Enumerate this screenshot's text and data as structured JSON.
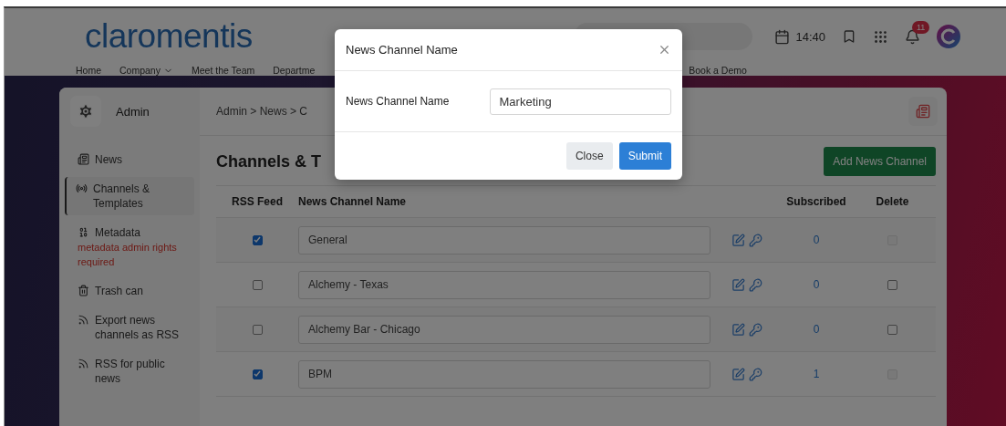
{
  "header": {
    "logo": "claromentis",
    "time": "14:40",
    "notification_count": "11",
    "nav": [
      {
        "label": "Home",
        "dropdown": false
      },
      {
        "label": "Company",
        "dropdown": true
      },
      {
        "label": "Meet the Team",
        "dropdown": false
      },
      {
        "label": "Departme",
        "dropdown": false
      },
      {
        "label": "Book a Demo",
        "dropdown": false
      }
    ]
  },
  "sidebar": {
    "title": "Admin",
    "items": [
      {
        "label": "News",
        "kind": "news",
        "selected": false
      },
      {
        "label": "Channels & Templates",
        "kind": "broadcast",
        "selected": true
      },
      {
        "label": "Metadata",
        "kind": "metadata",
        "selected": false,
        "note": "metadata admin rights required"
      },
      {
        "label": "Trash can",
        "kind": "trash",
        "selected": false
      },
      {
        "label": "Export news channels as RSS",
        "kind": "rss",
        "selected": false
      },
      {
        "label": "RSS for public news",
        "kind": "rss",
        "selected": false
      }
    ]
  },
  "breadcrumb": "Admin > News > C",
  "page_title": "Channels & T",
  "add_button": "Add News Channel",
  "table": {
    "columns": [
      "RSS Feed",
      "News Channel Name",
      "Subscribed",
      "Delete"
    ],
    "rows": [
      {
        "rss_feed": true,
        "name": "General",
        "subscribed": "0",
        "delete_checked": false,
        "delete_disabled": true
      },
      {
        "rss_feed": false,
        "name": "Alchemy - Texas",
        "subscribed": "0",
        "delete_checked": false,
        "delete_disabled": false
      },
      {
        "rss_feed": false,
        "name": "Alchemy Bar - Chicago",
        "subscribed": "0",
        "delete_checked": false,
        "delete_disabled": false
      },
      {
        "rss_feed": true,
        "name": "BPM",
        "subscribed": "1",
        "delete_checked": false,
        "delete_disabled": true
      }
    ]
  },
  "modal": {
    "title": "News Channel Name",
    "field_label": "News Channel Name",
    "field_value": "Marketing",
    "buttons": [
      {
        "label": "Close",
        "kind": "secondary"
      },
      {
        "label": "Submit",
        "kind": "primary"
      }
    ]
  }
}
